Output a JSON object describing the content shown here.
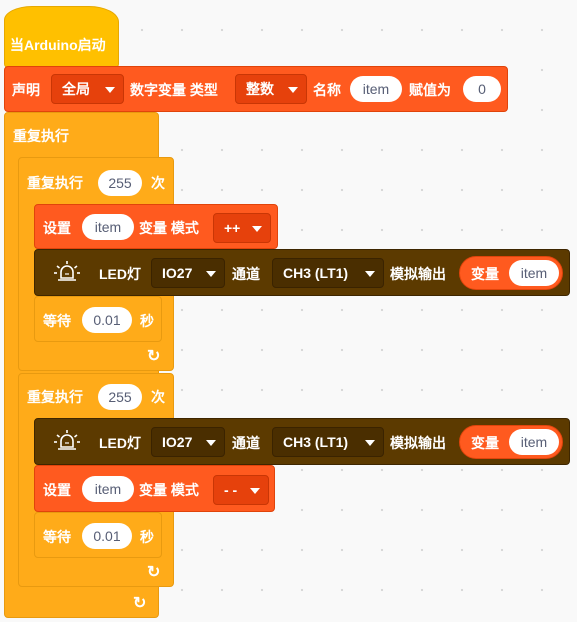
{
  "colors": {
    "hat": "#ffc000",
    "control": "#ffab19",
    "variable": "#ff5a1f",
    "led": "#5c3a00",
    "canvas": "#f9f9f9"
  },
  "hat_block": {
    "label": "当Arduino启动"
  },
  "declare_block": {
    "label": "声明",
    "scope": "全局",
    "type_label": "数字变量 类型",
    "data_type": "整数",
    "name_label": "名称",
    "var_name": "item",
    "init_label": "赋值为",
    "init_value": "0"
  },
  "forever_block": {
    "label": "重复执行",
    "loop_icon": "loop-arrow-icon"
  },
  "loop1": {
    "label": "重复执行",
    "count": "255",
    "times_label": "次",
    "set_block": {
      "label": "设置",
      "var_name": "item",
      "mode_label": "变量 模式",
      "mode": "++"
    },
    "led_block": {
      "icon": "led-bulb-icon",
      "label": "LED灯",
      "pin": "IO27",
      "channel_label": "通道",
      "channel": "CH3 (LT1)",
      "output_label": "模拟输出",
      "var_label": "变量",
      "var_name": "item"
    },
    "wait_block": {
      "label": "等待",
      "seconds": "0.01",
      "unit": "秒"
    }
  },
  "loop2": {
    "label": "重复执行",
    "count": "255",
    "times_label": "次",
    "led_block": {
      "icon": "led-bulb-icon",
      "label": "LED灯",
      "pin": "IO27",
      "channel_label": "通道",
      "channel": "CH3 (LT1)",
      "output_label": "模拟输出",
      "var_label": "变量",
      "var_name": "item"
    },
    "set_block": {
      "label": "设置",
      "var_name": "item",
      "mode_label": "变量 模式",
      "mode": "- -"
    },
    "wait_block": {
      "label": "等待",
      "seconds": "0.01",
      "unit": "秒"
    }
  }
}
